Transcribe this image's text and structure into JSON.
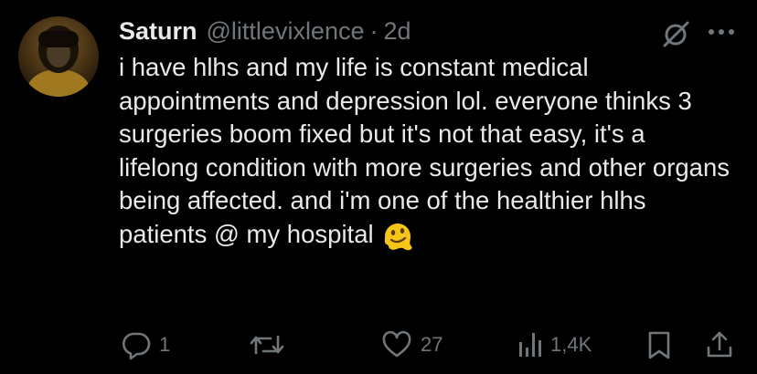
{
  "tweet": {
    "author_name": "Saturn",
    "handle": "@littlevixlence",
    "separator": "·",
    "time": "2d",
    "text": "i have hlhs and my life is constant medical appointments and depression lol. everyone thinks 3 surgeries boom fixed but it's not that easy, it's a lifelong condition with more surgeries and other organs being affected. and i'm one of the healthier hlhs patients @ my hospital",
    "emoji": "melting-face-emoji"
  },
  "actions": {
    "replies": "1",
    "reposts": "",
    "likes": "27",
    "views": "1,4K"
  },
  "colors": {
    "background": "#000000",
    "text": "#e7e9ea",
    "muted": "#71767b"
  }
}
